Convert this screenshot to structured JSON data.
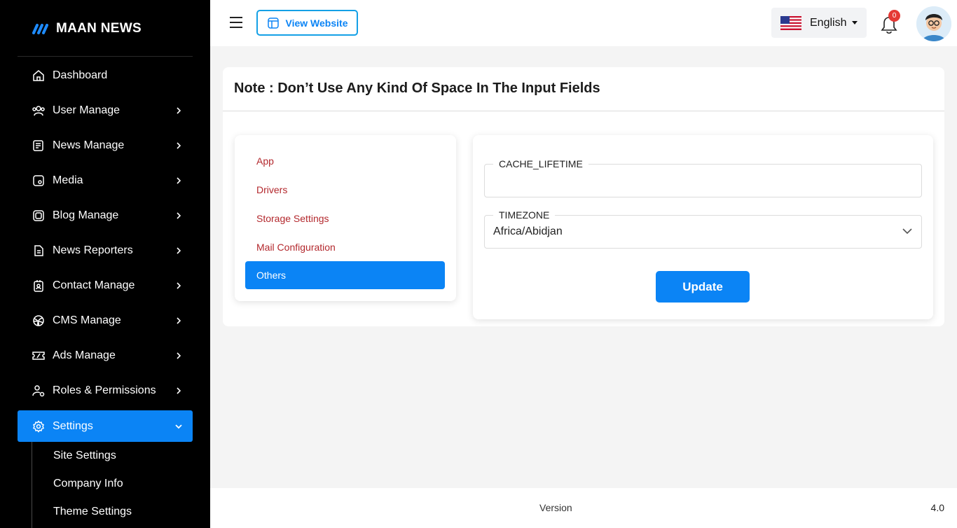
{
  "brand": {
    "name": "MAAN NEWS"
  },
  "sidebar": {
    "items": [
      {
        "label": "Dashboard",
        "icon": "home-icon"
      },
      {
        "label": "User Manage",
        "icon": "users-icon"
      },
      {
        "label": "News Manage",
        "icon": "news-icon"
      },
      {
        "label": "Media",
        "icon": "media-icon"
      },
      {
        "label": "Blog Manage",
        "icon": "blog-icon"
      },
      {
        "label": "News Reporters",
        "icon": "document-icon"
      },
      {
        "label": "Contact Manage",
        "icon": "contact-icon"
      },
      {
        "label": "CMS Manage",
        "icon": "globe-icon"
      },
      {
        "label": "Ads Manage",
        "icon": "ads-icon"
      },
      {
        "label": "Roles & Permissions",
        "icon": "user-shield-icon"
      },
      {
        "label": "Settings",
        "icon": "gear-icon"
      }
    ],
    "sub_items": [
      {
        "label": "Site Settings"
      },
      {
        "label": "Company Info"
      },
      {
        "label": "Theme Settings"
      }
    ]
  },
  "header": {
    "view_website_label": "View Website",
    "language": "English",
    "notification_count": "0"
  },
  "note": {
    "title": "Note : Don’t Use Any Kind Of Space In The Input Fields"
  },
  "settings_menu": {
    "items": [
      {
        "label": "App"
      },
      {
        "label": "Drivers"
      },
      {
        "label": "Storage Settings"
      },
      {
        "label": "Mail Configuration"
      },
      {
        "label": "Others"
      }
    ],
    "active_index": 4
  },
  "form": {
    "cache_label": "CACHE_LIFETIME",
    "cache_value": "",
    "timezone_label": "TIMEZONE",
    "timezone_value": "Africa/Abidjan",
    "update_label": "Update"
  },
  "footer": {
    "version_label": "Version",
    "version_number": "4.0"
  },
  "colors": {
    "accent": "#0b84f5",
    "menu_text": "#b3282d",
    "sidebar_bg": "#000000"
  }
}
